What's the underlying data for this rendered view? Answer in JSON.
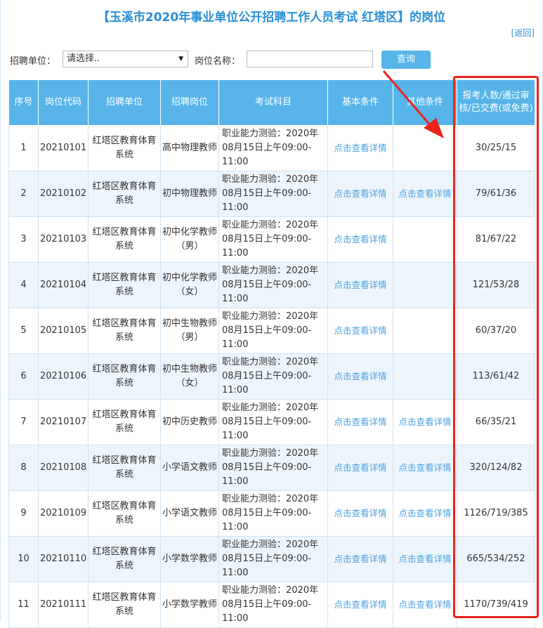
{
  "page": {
    "title": "【玉溪市2020年事业单位公开招聘工作人员考试 红塔区】的岗位",
    "back_link": "[返回]"
  },
  "filter": {
    "unit_label": "招聘单位：",
    "unit_select_value": "请选择..",
    "post_name_label": "岗位名称：",
    "post_name_value": "",
    "query_button": "查询"
  },
  "table": {
    "headers": [
      "序号",
      "岗位代码",
      "招聘单位",
      "招聘岗位",
      "考试科目",
      "基本条件",
      "其他条件",
      "报考人数/通过审核/已交费(或免费)"
    ],
    "rows": [
      {
        "no": "1",
        "code": "20210101",
        "unit": "红塔区教育体育系统",
        "post": "高中物理教师",
        "exam": "职业能力测验：2020年08月15日上午09:00-11:00",
        "basic": "点击查看详情",
        "other": "",
        "stats": "30/25/15"
      },
      {
        "no": "2",
        "code": "20210102",
        "unit": "红塔区教育体育系统",
        "post": "初中物理教师",
        "exam": "职业能力测验：2020年08月15日上午09:00-11:00",
        "basic": "点击查看详情",
        "other": "点击查看详情",
        "stats": "79/61/36"
      },
      {
        "no": "3",
        "code": "20210103",
        "unit": "红塔区教育体育系统",
        "post": "初中化学教师（男）",
        "exam": "职业能力测验：2020年08月15日上午09:00-11:00",
        "basic": "点击查看详情",
        "other": "",
        "stats": "81/67/22"
      },
      {
        "no": "4",
        "code": "20210104",
        "unit": "红塔区教育体育系统",
        "post": "初中化学教师（女）",
        "exam": "职业能力测验：2020年08月15日上午09:00-11:00",
        "basic": "点击查看详情",
        "other": "",
        "stats": "121/53/28"
      },
      {
        "no": "5",
        "code": "20210105",
        "unit": "红塔区教育体育系统",
        "post": "初中生物教师（男）",
        "exam": "职业能力测验：2020年08月15日上午09:00-11:00",
        "basic": "点击查看详情",
        "other": "",
        "stats": "60/37/20"
      },
      {
        "no": "6",
        "code": "20210106",
        "unit": "红塔区教育体育系统",
        "post": "初中生物教师（女）",
        "exam": "职业能力测验：2020年08月15日上午09:00-11:00",
        "basic": "点击查看详情",
        "other": "",
        "stats": "113/61/42"
      },
      {
        "no": "7",
        "code": "20210107",
        "unit": "红塔区教育体育系统",
        "post": "初中历史教师",
        "exam": "职业能力测验：2020年08月15日上午09:00-11:00",
        "basic": "点击查看详情",
        "other": "点击查看详情",
        "stats": "66/35/21"
      },
      {
        "no": "8",
        "code": "20210108",
        "unit": "红塔区教育体育系统",
        "post": "小学语文教师",
        "exam": "职业能力测验：2020年08月15日上午09:00-11:00",
        "basic": "点击查看详情",
        "other": "点击查看详情",
        "stats": "320/124/82"
      },
      {
        "no": "9",
        "code": "20210109",
        "unit": "红塔区教育体育系统",
        "post": "小学语文教师",
        "exam": "职业能力测验：2020年08月15日上午09:00-11:00",
        "basic": "点击查看详情",
        "other": "点击查看详情",
        "stats": "1126/719/385"
      },
      {
        "no": "10",
        "code": "20210110",
        "unit": "红塔区教育体育系统",
        "post": "小学数学教师",
        "exam": "职业能力测验：2020年08月15日上午09:00-11:00",
        "basic": "点击查看详情",
        "other": "点击查看详情",
        "stats": "665/534/252"
      },
      {
        "no": "11",
        "code": "20210111",
        "unit": "红塔区教育体育系统",
        "post": "小学数学教师",
        "exam": "职业能力测验：2020年08月15日上午09:00-11:00",
        "basic": "点击查看详情",
        "other": "点击查看详情",
        "stats": "1170/739/419"
      }
    ]
  },
  "annotation": {
    "highlight_color": "#e8241b",
    "header_color": "#56b4e9",
    "link_color": "#4aa3df"
  }
}
